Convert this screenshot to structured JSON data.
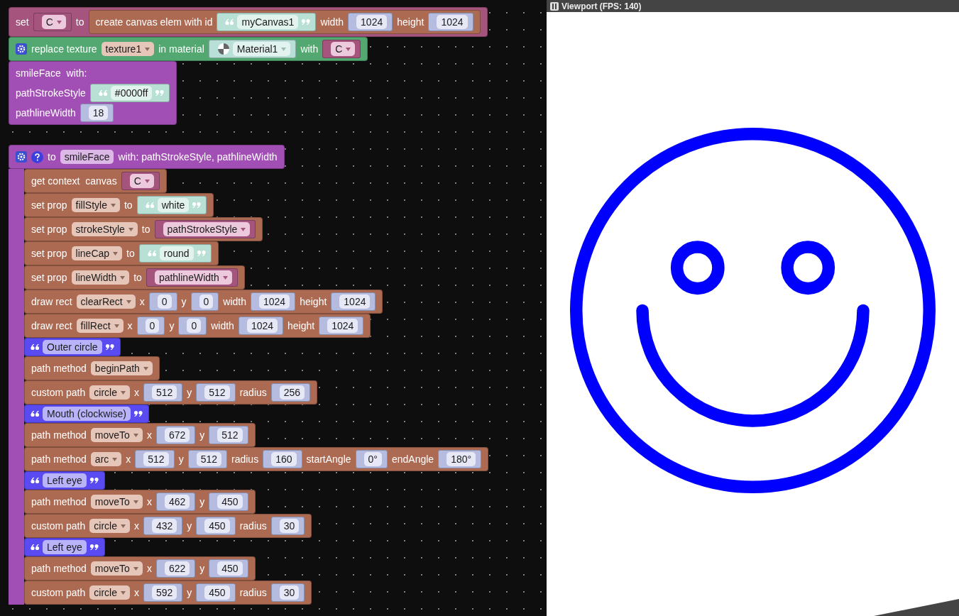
{
  "workspace": {
    "top_stack": [
      {
        "kind": "variables",
        "parts": [
          {
            "kind": "label",
            "text": "set"
          },
          {
            "kind": "variable",
            "text": "C"
          },
          {
            "kind": "label",
            "text": "to"
          },
          {
            "kind": "block",
            "block": {
              "kind": "canvas",
              "parts": [
                {
                  "kind": "label",
                  "text": "create canvas elem with id"
                },
                {
                  "kind": "string",
                  "text": "myCanvas1"
                },
                {
                  "kind": "label",
                  "text": "width"
                },
                {
                  "kind": "number",
                  "text": "1024"
                },
                {
                  "kind": "label",
                  "text": "height"
                },
                {
                  "kind": "number",
                  "text": "1024"
                }
              ]
            }
          }
        ]
      },
      {
        "kind": "texture",
        "parts": [
          {
            "kind": "gear"
          },
          {
            "kind": "label",
            "text": "replace texture"
          },
          {
            "kind": "dropdown",
            "text": "texture1"
          },
          {
            "kind": "label",
            "text": "in material"
          },
          {
            "kind": "material",
            "text": "Material1"
          },
          {
            "kind": "label",
            "text": "with"
          },
          {
            "kind": "variable",
            "text": "C"
          }
        ]
      },
      {
        "kind": "procedure",
        "rows": [
          [
            {
              "kind": "label",
              "text": "smileFace  with:"
            }
          ],
          [
            {
              "kind": "label",
              "text": "pathStrokeStyle"
            },
            {
              "kind": "string",
              "text": "#0000ff"
            }
          ],
          [
            {
              "kind": "label",
              "text": "pathlineWidth"
            },
            {
              "kind": "number",
              "text": "18"
            }
          ]
        ]
      }
    ],
    "definition": {
      "kind": "procedure",
      "parts": [
        {
          "kind": "gear"
        },
        {
          "kind": "help"
        },
        {
          "kind": "label",
          "text": "to"
        },
        {
          "kind": "name",
          "text": "smileFace"
        },
        {
          "kind": "label",
          "text": "with: pathStrokeStyle, pathlineWidth"
        }
      ],
      "body": [
        {
          "kind": "canvas",
          "parts": [
            {
              "kind": "label",
              "text": "get context  canvas"
            },
            {
              "kind": "variable",
              "text": "C"
            }
          ]
        },
        {
          "kind": "canvas",
          "parts": [
            {
              "kind": "label",
              "text": "set prop"
            },
            {
              "kind": "dropdown",
              "text": "fillStyle"
            },
            {
              "kind": "label",
              "text": "to"
            },
            {
              "kind": "string",
              "text": "white"
            }
          ]
        },
        {
          "kind": "canvas",
          "parts": [
            {
              "kind": "label",
              "text": "set prop"
            },
            {
              "kind": "dropdown",
              "text": "strokeStyle"
            },
            {
              "kind": "label",
              "text": "to"
            },
            {
              "kind": "variable",
              "text": "pathStrokeStyle"
            }
          ]
        },
        {
          "kind": "canvas",
          "parts": [
            {
              "kind": "label",
              "text": "set prop"
            },
            {
              "kind": "dropdown",
              "text": "lineCap"
            },
            {
              "kind": "label",
              "text": "to"
            },
            {
              "kind": "string",
              "text": "round"
            }
          ]
        },
        {
          "kind": "canvas",
          "parts": [
            {
              "kind": "label",
              "text": "set prop"
            },
            {
              "kind": "dropdown",
              "text": "lineWidth"
            },
            {
              "kind": "label",
              "text": "to"
            },
            {
              "kind": "variable",
              "text": "pathlineWidth"
            }
          ]
        },
        {
          "kind": "canvas",
          "parts": [
            {
              "kind": "label",
              "text": "draw rect"
            },
            {
              "kind": "dropdown",
              "text": "clearRect"
            },
            {
              "kind": "label",
              "text": "x"
            },
            {
              "kind": "number",
              "text": "0"
            },
            {
              "kind": "label",
              "text": "y"
            },
            {
              "kind": "number",
              "text": "0"
            },
            {
              "kind": "label",
              "text": "width"
            },
            {
              "kind": "number",
              "text": "1024"
            },
            {
              "kind": "label",
              "text": "height"
            },
            {
              "kind": "number",
              "text": "1024"
            }
          ]
        },
        {
          "kind": "canvas",
          "parts": [
            {
              "kind": "label",
              "text": "draw rect"
            },
            {
              "kind": "dropdown",
              "text": "fillRect"
            },
            {
              "kind": "label",
              "text": "x"
            },
            {
              "kind": "number",
              "text": "0"
            },
            {
              "kind": "label",
              "text": "y"
            },
            {
              "kind": "number",
              "text": "0"
            },
            {
              "kind": "label",
              "text": "width"
            },
            {
              "kind": "number",
              "text": "1024"
            },
            {
              "kind": "label",
              "text": "height"
            },
            {
              "kind": "number",
              "text": "1024"
            }
          ]
        },
        {
          "kind": "note",
          "parts": [
            {
              "kind": "quoted",
              "text": "Outer circle"
            }
          ]
        },
        {
          "kind": "canvas",
          "parts": [
            {
              "kind": "label",
              "text": "path method"
            },
            {
              "kind": "dropdown",
              "text": "beginPath"
            }
          ]
        },
        {
          "kind": "canvas",
          "parts": [
            {
              "kind": "label",
              "text": "custom path"
            },
            {
              "kind": "dropdown",
              "text": "circle"
            },
            {
              "kind": "label",
              "text": "x"
            },
            {
              "kind": "number",
              "text": "512"
            },
            {
              "kind": "label",
              "text": "y"
            },
            {
              "kind": "number",
              "text": "512"
            },
            {
              "kind": "label",
              "text": "radius"
            },
            {
              "kind": "number",
              "text": "256"
            }
          ]
        },
        {
          "kind": "note",
          "parts": [
            {
              "kind": "quoted",
              "text": "Mouth (clockwise)"
            }
          ]
        },
        {
          "kind": "canvas",
          "parts": [
            {
              "kind": "label",
              "text": "path method"
            },
            {
              "kind": "dropdown",
              "text": "moveTo"
            },
            {
              "kind": "label",
              "text": "x"
            },
            {
              "kind": "number",
              "text": "672"
            },
            {
              "kind": "label",
              "text": "y"
            },
            {
              "kind": "number",
              "text": "512"
            }
          ]
        },
        {
          "kind": "canvas",
          "parts": [
            {
              "kind": "label",
              "text": "path method"
            },
            {
              "kind": "dropdown",
              "text": "arc"
            },
            {
              "kind": "label",
              "text": "x"
            },
            {
              "kind": "number",
              "text": "512"
            },
            {
              "kind": "label",
              "text": "y"
            },
            {
              "kind": "number",
              "text": "512"
            },
            {
              "kind": "label",
              "text": "radius"
            },
            {
              "kind": "number",
              "text": "160"
            },
            {
              "kind": "label",
              "text": "startAngle"
            },
            {
              "kind": "number",
              "text": "0°"
            },
            {
              "kind": "label",
              "text": "endAngle"
            },
            {
              "kind": "number",
              "text": "180°"
            }
          ]
        },
        {
          "kind": "note",
          "parts": [
            {
              "kind": "quoted",
              "text": "Left eye"
            }
          ]
        },
        {
          "kind": "canvas",
          "parts": [
            {
              "kind": "label",
              "text": "path method"
            },
            {
              "kind": "dropdown",
              "text": "moveTo"
            },
            {
              "kind": "label",
              "text": "x"
            },
            {
              "kind": "number",
              "text": "462"
            },
            {
              "kind": "label",
              "text": "y"
            },
            {
              "kind": "number",
              "text": "450"
            }
          ]
        },
        {
          "kind": "canvas",
          "parts": [
            {
              "kind": "label",
              "text": "custom path"
            },
            {
              "kind": "dropdown",
              "text": "circle"
            },
            {
              "kind": "label",
              "text": "x"
            },
            {
              "kind": "number",
              "text": "432"
            },
            {
              "kind": "label",
              "text": "y"
            },
            {
              "kind": "number",
              "text": "450"
            },
            {
              "kind": "label",
              "text": "radius"
            },
            {
              "kind": "number",
              "text": "30"
            }
          ]
        },
        {
          "kind": "note",
          "parts": [
            {
              "kind": "quoted",
              "text": "Left eye"
            }
          ]
        },
        {
          "kind": "canvas",
          "parts": [
            {
              "kind": "label",
              "text": "path method"
            },
            {
              "kind": "dropdown",
              "text": "moveTo"
            },
            {
              "kind": "label",
              "text": "x"
            },
            {
              "kind": "number",
              "text": "622"
            },
            {
              "kind": "label",
              "text": "y"
            },
            {
              "kind": "number",
              "text": "450"
            }
          ]
        },
        {
          "kind": "canvas",
          "parts": [
            {
              "kind": "label",
              "text": "custom path"
            },
            {
              "kind": "dropdown",
              "text": "circle"
            },
            {
              "kind": "label",
              "text": "x"
            },
            {
              "kind": "number",
              "text": "592"
            },
            {
              "kind": "label",
              "text": "y"
            },
            {
              "kind": "number",
              "text": "450"
            },
            {
              "kind": "label",
              "text": "radius"
            },
            {
              "kind": "number",
              "text": "30"
            }
          ]
        }
      ]
    }
  },
  "viewport": {
    "title": "Viewport (FPS: 140)"
  }
}
